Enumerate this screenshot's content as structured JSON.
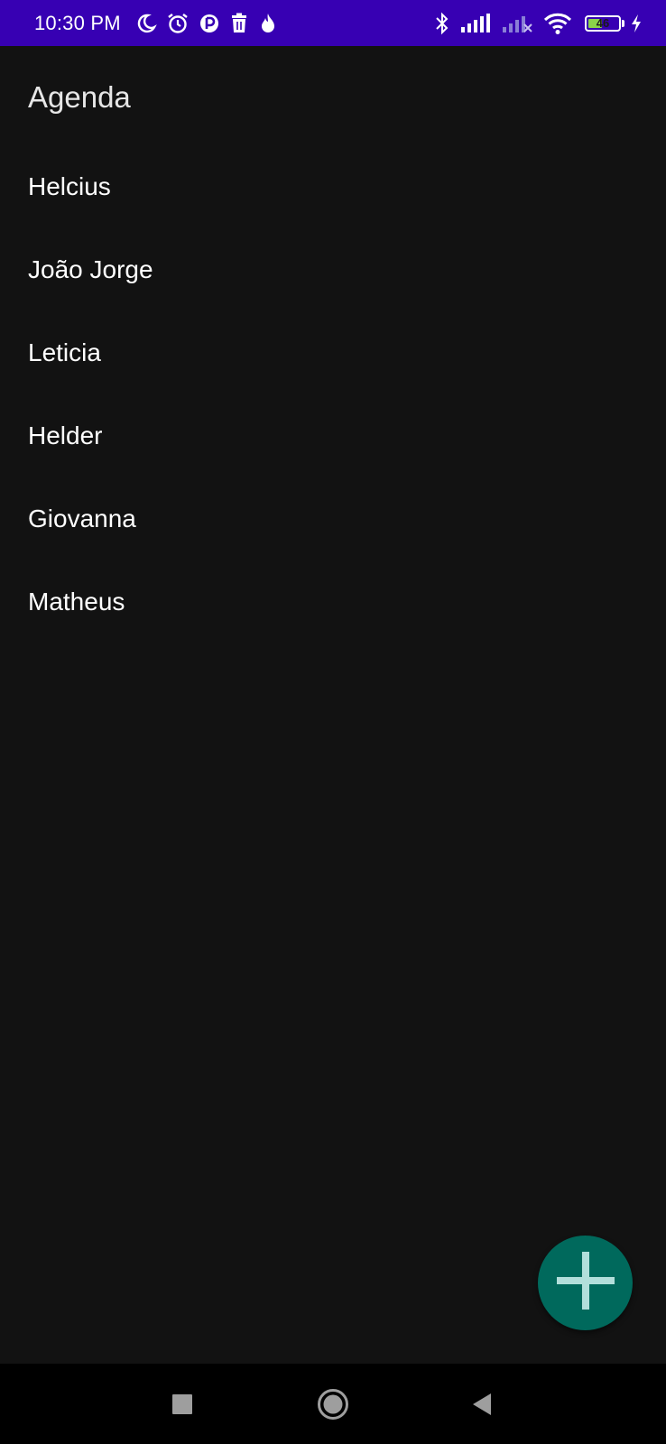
{
  "status_bar": {
    "time": "10:30 PM",
    "battery_level": "46",
    "battery_fraction": 0.46,
    "left_icons": [
      "moon-icon",
      "alarm-icon",
      "app-notification-icon",
      "trash-icon",
      "flame-icon"
    ],
    "right_icons": [
      "bluetooth-icon",
      "signal-icon",
      "signal-no-service-icon",
      "wifi-icon",
      "battery-icon",
      "charging-icon"
    ],
    "background_color": "#3700b3"
  },
  "app": {
    "title": "Agenda",
    "background_color": "#121212"
  },
  "contacts": [
    {
      "name": "Helcius"
    },
    {
      "name": "João Jorge"
    },
    {
      "name": "Leticia"
    },
    {
      "name": "Helder"
    },
    {
      "name": "Giovanna"
    },
    {
      "name": "Matheus"
    }
  ],
  "fab": {
    "icon": "plus-icon",
    "color": "#00695c"
  },
  "navigation_bar": {
    "buttons": [
      "recents-button",
      "home-button",
      "back-button"
    ]
  }
}
